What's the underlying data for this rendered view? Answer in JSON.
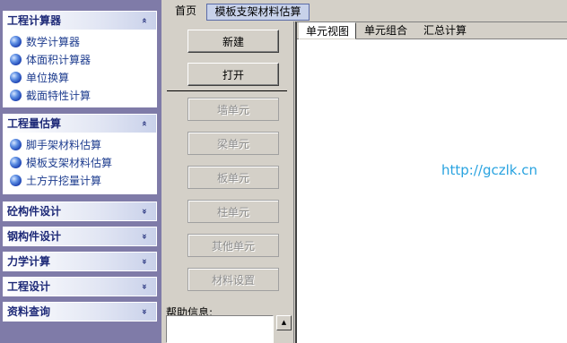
{
  "sidebar": {
    "groups": [
      {
        "title": "工程计算器",
        "chevron": "«",
        "items": [
          "数学计算器",
          "体面积计算器",
          "单位换算",
          "截面特性计算"
        ]
      },
      {
        "title": "工程量估算",
        "chevron": "«",
        "items": [
          "脚手架材料估算",
          "模板支架材料估算",
          "土方开挖量计算"
        ]
      }
    ],
    "collapsed": [
      {
        "title": "砼构件设计",
        "chevron": "»"
      },
      {
        "title": "钢构件设计",
        "chevron": "»"
      },
      {
        "title": "力学计算",
        "chevron": "»"
      },
      {
        "title": "工程设计",
        "chevron": "»"
      },
      {
        "title": "资料查询",
        "chevron": "»"
      }
    ]
  },
  "top_tabs": [
    "首页",
    "模板支架材料估算"
  ],
  "buttons": {
    "new": "新建",
    "open": "打开",
    "wall": "墙单元",
    "beam": "梁单元",
    "slab": "板单元",
    "column": "柱单元",
    "other": "其他单元",
    "material": "材料设置"
  },
  "help": {
    "label": "帮助信息:",
    "text": ""
  },
  "sub_tabs": [
    "单元视图",
    "单元组合",
    "汇总计算"
  ],
  "watermark": "http://gczlk.cn",
  "colors": {
    "sidebar_bg": "#7f7ba8",
    "header_text": "#1e2a78",
    "item_text": "#1e3d8f",
    "watermark": "#29a3e0",
    "active_tab": "#c8d2ea"
  },
  "icons": {
    "expand": "chevron-double-up-icon",
    "collapse": "chevron-double-down-icon",
    "item": "blue-ball-icon"
  }
}
